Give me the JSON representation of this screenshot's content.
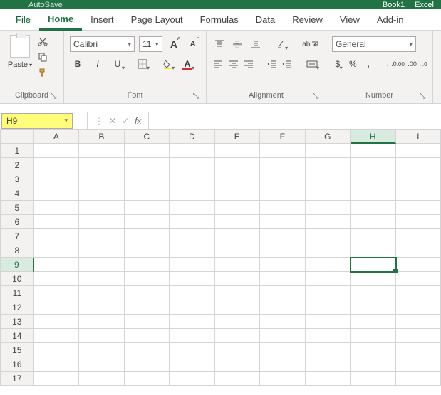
{
  "title": {
    "autosave": "AutoSave",
    "book": "Book1",
    "app": "Excel"
  },
  "tabs": {
    "file": "File",
    "home": "Home",
    "insert": "Insert",
    "page_layout": "Page Layout",
    "formulas": "Formulas",
    "data": "Data",
    "review": "Review",
    "view": "View",
    "addins": "Add-in"
  },
  "ribbon": {
    "clipboard": {
      "paste": "Paste",
      "label": "Clipboard"
    },
    "font": {
      "name": "Calibri",
      "size": "11",
      "label": "Font",
      "bold": "B",
      "italic": "I",
      "underline": "U",
      "incfont": "A",
      "decfont": "A"
    },
    "alignment": {
      "label": "Alignment",
      "wrap": "ab"
    },
    "number": {
      "label": "Number",
      "format": "General",
      "currency": "$",
      "percent": "%",
      "comma": ",",
      "incdec": ".0",
      "decdec": ".00"
    }
  },
  "fxbar": {
    "namebox": "H9",
    "cancel": "✕",
    "enter": "✓",
    "fx": "fx",
    "formula": ""
  },
  "grid": {
    "cols": [
      "A",
      "B",
      "C",
      "D",
      "E",
      "F",
      "G",
      "H",
      "I"
    ],
    "rows": [
      "1",
      "2",
      "3",
      "4",
      "5",
      "6",
      "7",
      "8",
      "9",
      "10",
      "11",
      "12",
      "13",
      "14",
      "15",
      "16",
      "17"
    ],
    "selected_col": "H",
    "selected_row": "9"
  }
}
